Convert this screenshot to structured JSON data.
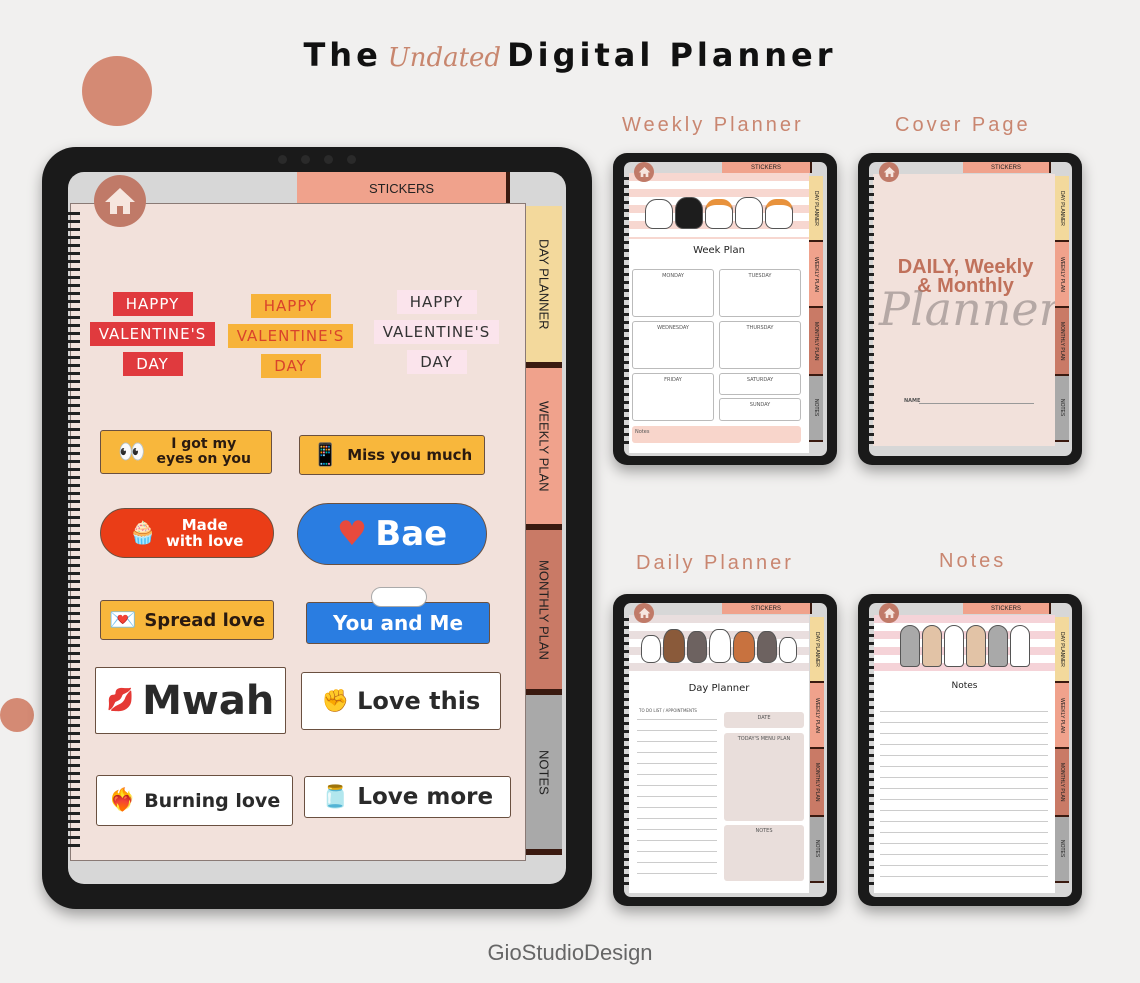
{
  "header": {
    "title_prefix": "The",
    "title_script": "Undated",
    "title_suffix": "Digital Planner"
  },
  "brand": "GioStudioDesign",
  "colors": {
    "accent": "#c98670",
    "circle": "#d48a74",
    "tab_day": "#f3d99c",
    "tab_week": "#f0a28c",
    "tab_month": "#c97a66",
    "tab_notes": "#a9a9a9",
    "page_bg": "#f2e1db"
  },
  "main_tablet": {
    "top_tab": "STICKERS",
    "home_icon": "home-icon",
    "side_tabs": [
      "DAY PLANNER",
      "WEEKLY PLAN",
      "MONTHLY PLAN",
      "NOTES"
    ],
    "valentine_stickers": [
      {
        "line1": "HAPPY",
        "line2": "VALENTINE'S",
        "line3": "DAY",
        "style": "red"
      },
      {
        "line1": "HAPPY",
        "line2": "VALENTINE'S",
        "line3": "DAY",
        "style": "yellow"
      },
      {
        "line1": "HAPPY",
        "line2": "VALENTINE'S",
        "line3": "DAY",
        "style": "pink"
      }
    ],
    "stickers": [
      {
        "text": "I got my eyes on you",
        "icon": "eyes-icon"
      },
      {
        "text": "Miss you much",
        "icon": "phone-icon"
      },
      {
        "text": "Made with love",
        "icon": "cupcake-icon"
      },
      {
        "text": "Bae",
        "icon": "heart-hug-icon"
      },
      {
        "text": "Spread love",
        "icon": "envelope-icon"
      },
      {
        "text": "You and Me",
        "icon": "cloud-icon"
      },
      {
        "text": "Mwah",
        "icon": "lips-icon"
      },
      {
        "text": "Love this",
        "icon": "sign-icon"
      },
      {
        "text": "Burning love",
        "icon": "fire-heart-icon"
      },
      {
        "text": "Love more",
        "icon": "jar-icon"
      }
    ]
  },
  "previews": [
    {
      "label": "Weekly Planner",
      "top_tab": "STICKERS",
      "side_tabs": [
        "DAY PLANNER",
        "WEEKLY PLAN",
        "MONTHLY PLAN",
        "NOTES"
      ],
      "heading": "Week Plan",
      "days": [
        "MONDAY",
        "TUESDAY",
        "WEDNESDAY",
        "THURSDAY",
        "FRIDAY",
        "SATURDAY",
        "SUNDAY"
      ],
      "notes_label": "Notes"
    },
    {
      "label": "Cover Page",
      "top_tab": "STICKERS",
      "side_tabs": [
        "DAY PLANNER",
        "WEEKLY PLAN",
        "MONTHLY PLAN",
        "NOTES"
      ],
      "heading_line1": "DAILY, Weekly",
      "heading_line2": "& Monthly",
      "script": "Planner",
      "name_label": "NAME"
    },
    {
      "label": "Daily Planner",
      "top_tab": "STICKERS",
      "side_tabs": [
        "DAY PLANNER",
        "WEEKLY PLAN",
        "MONTHLY PLAN",
        "NOTES"
      ],
      "heading": "Day Planner",
      "todo_label": "TO DO LIST / APPOINTMENTS",
      "date_label": "DATE",
      "menu_label": "TODAY'S MENU PLAN",
      "notes_label": "NOTES"
    },
    {
      "label": "Notes",
      "top_tab": "STICKERS",
      "side_tabs": [
        "DAY PLANNER",
        "WEEKLY PLAN",
        "MONTHLY PLAN",
        "NOTES"
      ],
      "heading": "Notes"
    }
  ]
}
